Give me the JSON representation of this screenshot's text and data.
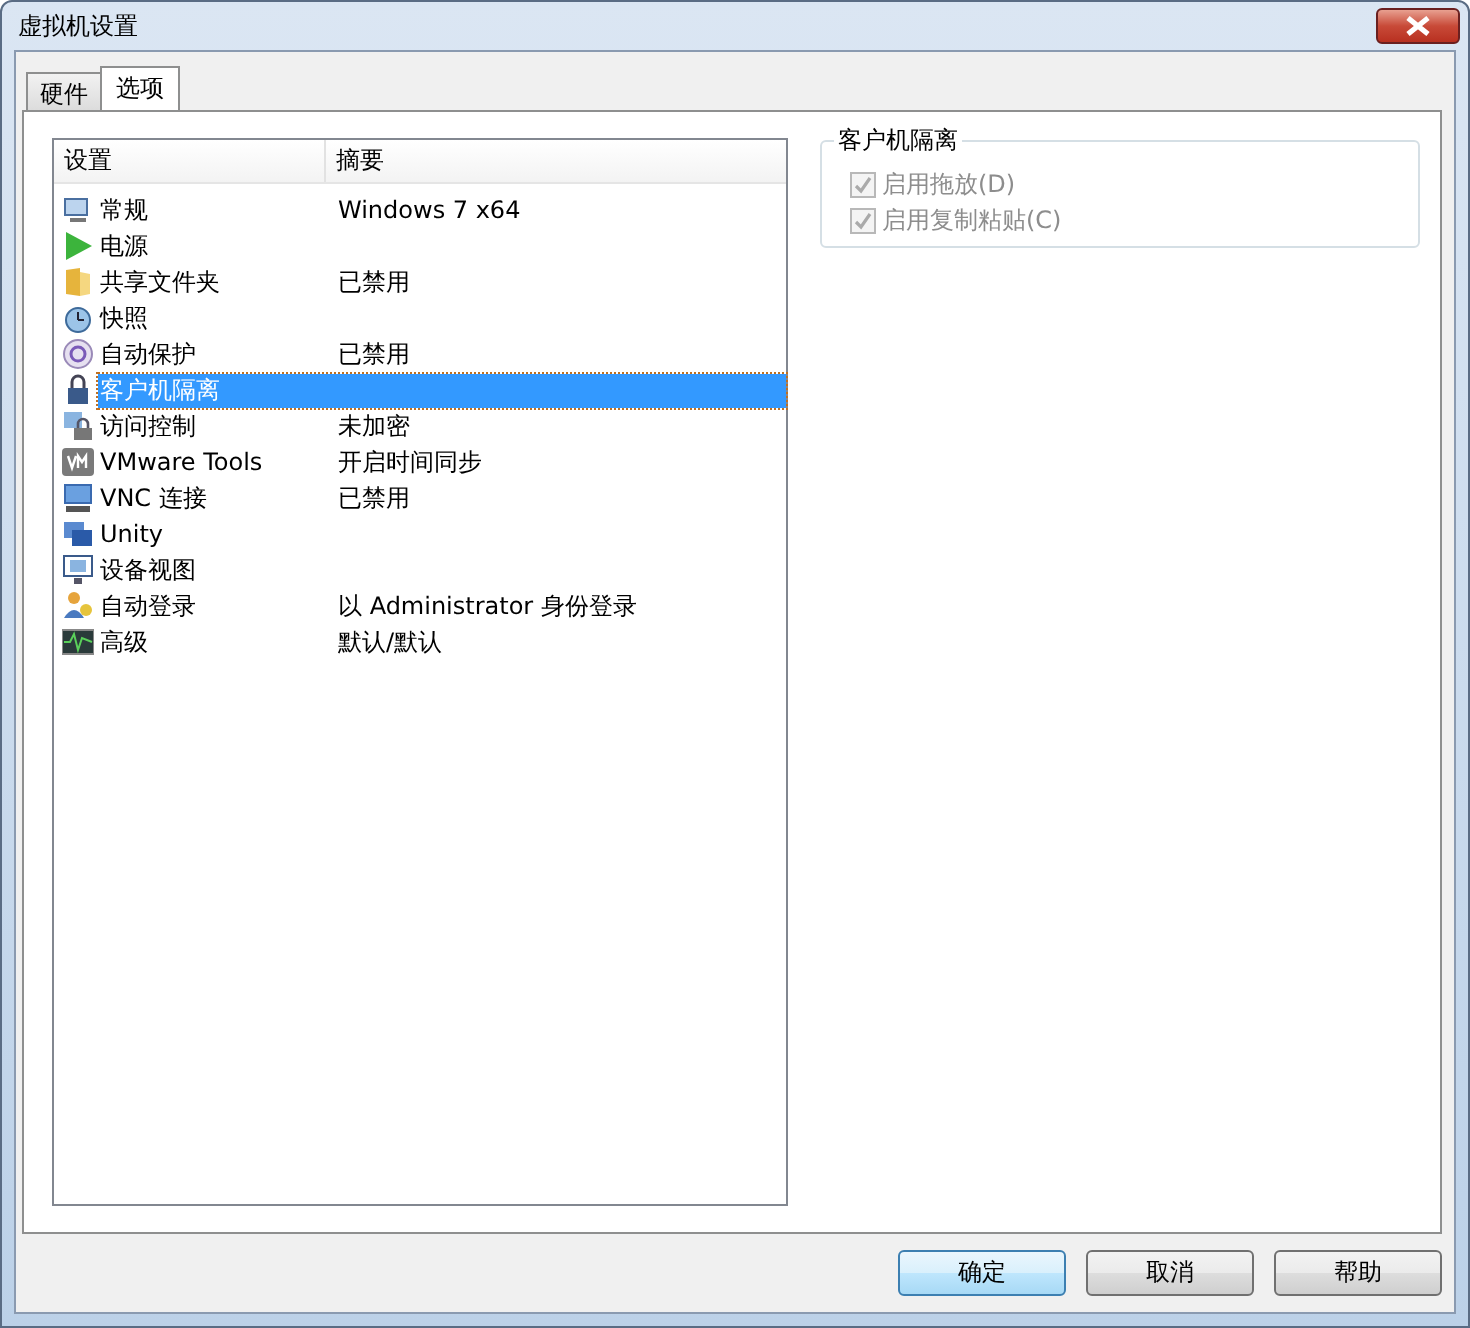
{
  "window": {
    "title": "虚拟机设置"
  },
  "tabs": [
    {
      "label": "硬件",
      "selected": false
    },
    {
      "label": "选项",
      "selected": true
    }
  ],
  "list": {
    "columns": [
      "设置",
      "摘要"
    ],
    "rows": [
      {
        "name": "常规",
        "summary": "Windows 7 x64",
        "selected": false
      },
      {
        "name": "电源",
        "summary": "",
        "selected": false
      },
      {
        "name": "共享文件夹",
        "summary": "已禁用",
        "selected": false
      },
      {
        "name": "快照",
        "summary": "",
        "selected": false
      },
      {
        "name": "自动保护",
        "summary": "已禁用",
        "selected": false
      },
      {
        "name": "客户机隔离",
        "summary": "",
        "selected": true
      },
      {
        "name": "访问控制",
        "summary": "未加密",
        "selected": false
      },
      {
        "name": "VMware Tools",
        "summary": "开启时间同步",
        "selected": false
      },
      {
        "name": "VNC 连接",
        "summary": "已禁用",
        "selected": false
      },
      {
        "name": "Unity",
        "summary": "",
        "selected": false
      },
      {
        "name": "设备视图",
        "summary": "",
        "selected": false
      },
      {
        "name": "自动登录",
        "summary": "以 Administrator 身份登录",
        "selected": false
      },
      {
        "name": "高级",
        "summary": "默认/默认",
        "selected": false
      }
    ]
  },
  "group": {
    "title": "客户机隔离",
    "options": [
      {
        "label": "启用拖放(D)",
        "checked": true,
        "disabled": true
      },
      {
        "label": "启用复制粘贴(C)",
        "checked": true,
        "disabled": true
      }
    ]
  },
  "buttons": [
    {
      "label": "确定",
      "default": true
    },
    {
      "label": "取消",
      "default": false
    },
    {
      "label": "帮助",
      "default": false
    }
  ]
}
